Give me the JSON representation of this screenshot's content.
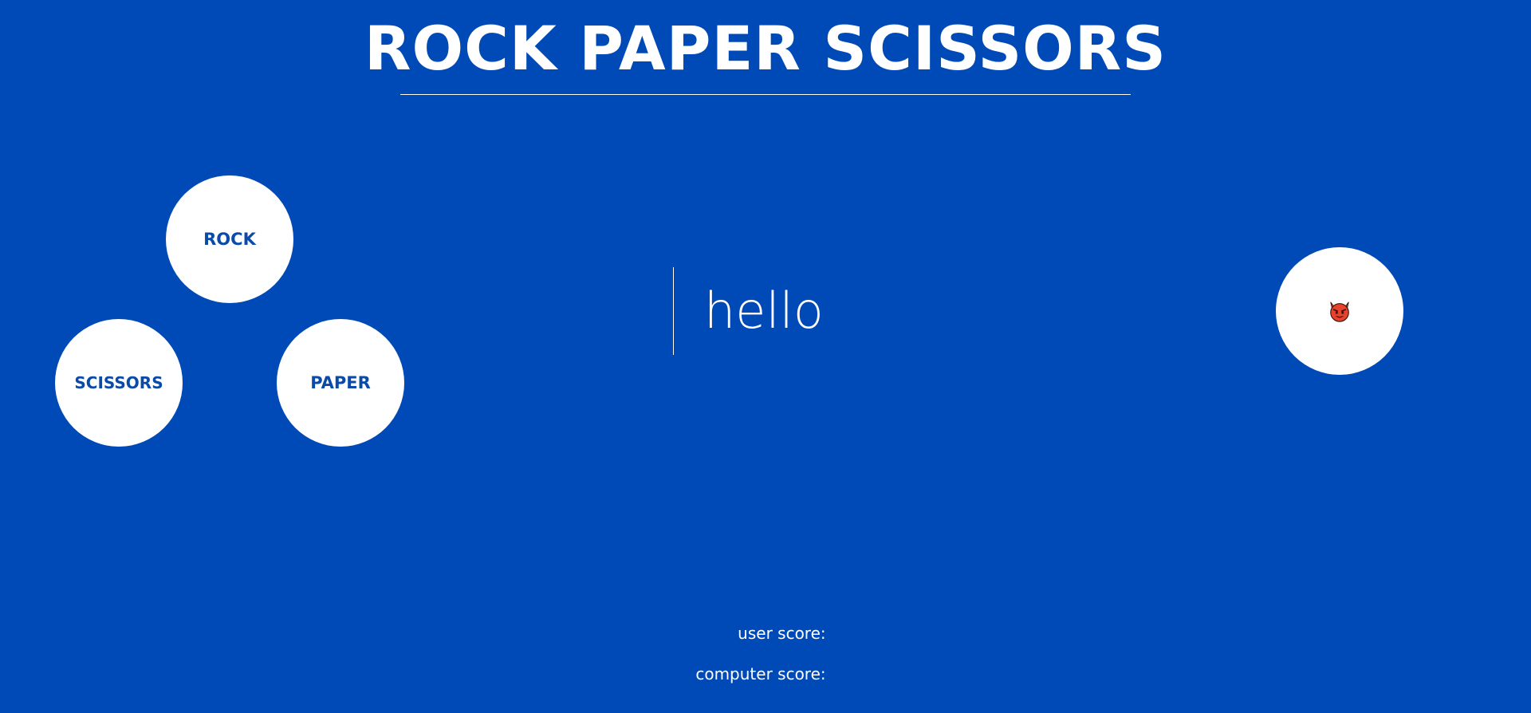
{
  "game": {
    "title": "ROCK PAPER SCISSORS"
  },
  "choices": {
    "rock": "ROCK",
    "paper": "PAPER",
    "scissors": "SCISSORS"
  },
  "result": {
    "message": "hello"
  },
  "computer": {
    "icon": "devil-face-icon",
    "icon_color": "#e8412c"
  },
  "scores": {
    "user_label": "user score:",
    "user_value": "",
    "computer_label": "computer score:",
    "computer_value": ""
  },
  "colors": {
    "background": "#004ab7",
    "button_bg": "#ffffff",
    "button_text": "#0a4aa8"
  }
}
